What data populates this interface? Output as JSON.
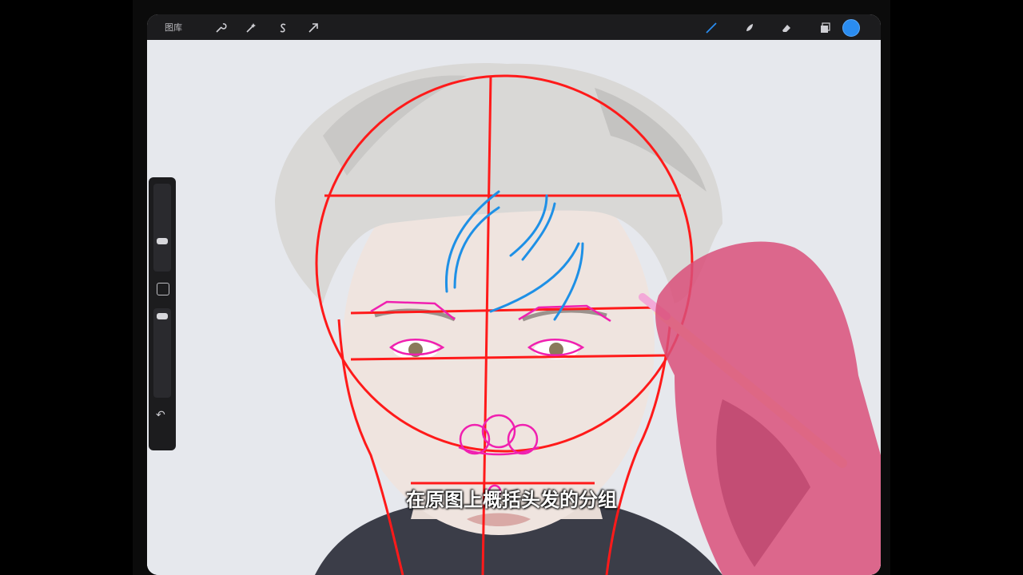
{
  "app": {
    "gallery_label": "图库",
    "accent_color": "#2a8cf0"
  },
  "toolbar": {
    "left_tools": [
      "wrench-icon",
      "magic-wand-icon",
      "selection-s-icon",
      "arrow-transform-icon"
    ],
    "right_tools": [
      "brush-icon",
      "smudge-icon",
      "eraser-icon",
      "layers-icon",
      "color-picker-icon"
    ]
  },
  "sidebar": {
    "brush_size_level": 0.75,
    "opacity_level": 0.9,
    "modify_button_icon": "square-icon",
    "undo_icon": "undo-icon"
  },
  "video": {
    "subtitle": "在原图上概括头发的分组"
  }
}
